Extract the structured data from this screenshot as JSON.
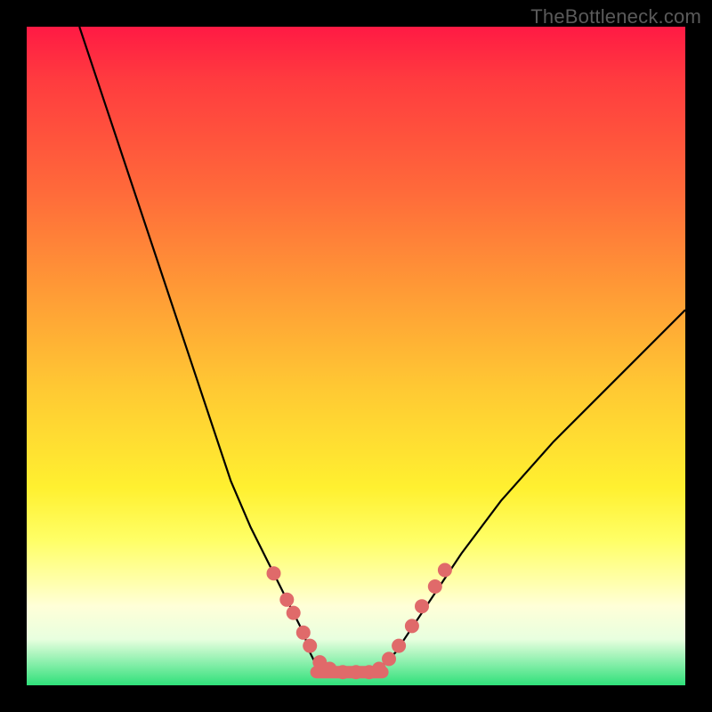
{
  "watermark": "TheBottleneck.com",
  "chart_data": {
    "type": "line",
    "title": "",
    "xlabel": "",
    "ylabel": "",
    "xlim": [
      0,
      100
    ],
    "ylim": [
      0,
      100
    ],
    "grid": false,
    "series": [
      {
        "name": "bottleneck-curve",
        "x": [
          8,
          12,
          16,
          20,
          24,
          28,
          31,
          34,
          37,
          40,
          42,
          43,
          44,
          46,
          48,
          50,
          52,
          54,
          56,
          58,
          62,
          66,
          72,
          80,
          90,
          100
        ],
        "y": [
          100,
          88,
          76,
          64,
          52,
          40,
          31,
          24,
          18,
          12,
          8,
          5,
          3,
          2,
          2,
          2,
          2,
          3,
          5,
          8,
          14,
          20,
          28,
          37,
          47,
          57
        ]
      }
    ],
    "markers": {
      "name": "highlighted-points",
      "color": "#e06a6a",
      "points": [
        {
          "x": 37.5,
          "y": 17
        },
        {
          "x": 39.5,
          "y": 13
        },
        {
          "x": 40.5,
          "y": 11
        },
        {
          "x": 42.0,
          "y": 8
        },
        {
          "x": 43.0,
          "y": 6
        },
        {
          "x": 44.5,
          "y": 3.5
        },
        {
          "x": 46.0,
          "y": 2.5
        },
        {
          "x": 48.0,
          "y": 2
        },
        {
          "x": 50.0,
          "y": 2
        },
        {
          "x": 52.0,
          "y": 2
        },
        {
          "x": 53.5,
          "y": 2.5
        },
        {
          "x": 55.0,
          "y": 4
        },
        {
          "x": 56.5,
          "y": 6
        },
        {
          "x": 58.5,
          "y": 9
        },
        {
          "x": 60.0,
          "y": 12
        },
        {
          "x": 62.0,
          "y": 15
        },
        {
          "x": 63.5,
          "y": 17.5
        }
      ]
    }
  }
}
